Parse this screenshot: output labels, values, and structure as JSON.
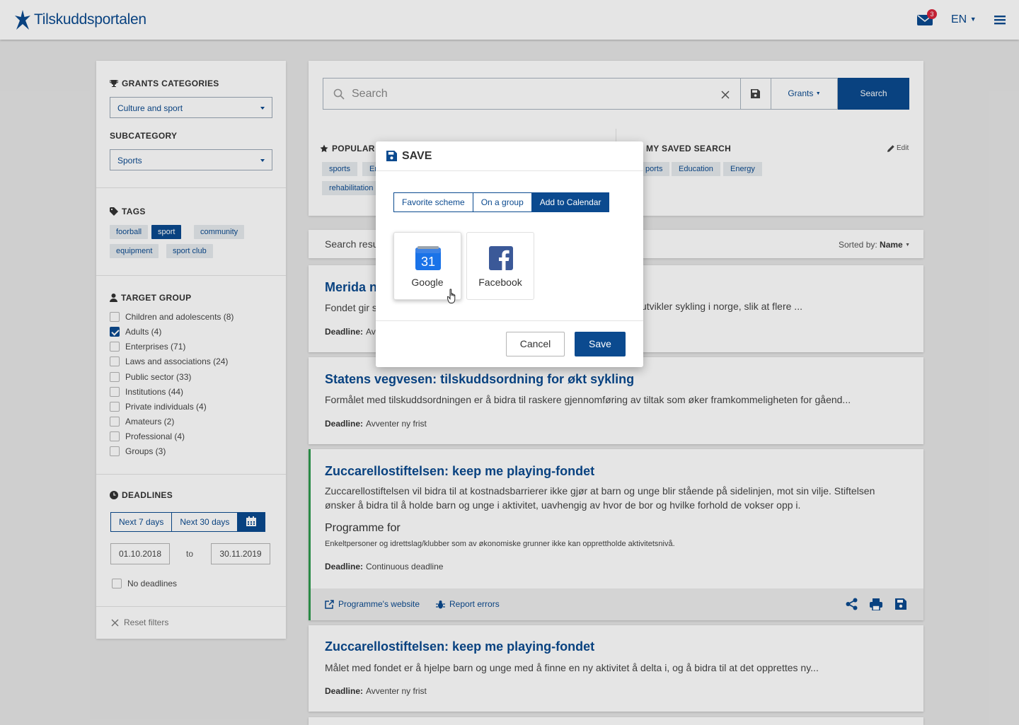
{
  "header": {
    "logo_text": "Tilskuddsportalen",
    "mail_count": "3",
    "language": "EN"
  },
  "sidebar": {
    "grants_heading": "GRANTS CATEGORIES",
    "grants_value": "Culture and sport",
    "subcategory_heading": "SUBCATEGORY",
    "subcategory_value": "Sports",
    "tags_heading": "TAGS",
    "tags": [
      {
        "label": "foorball",
        "active": false
      },
      {
        "label": "sport",
        "active": true
      },
      {
        "label": "community",
        "active": false
      },
      {
        "label": "equipment",
        "active": false
      },
      {
        "label": "sport club",
        "active": false
      }
    ],
    "target_heading": "TARGET GROUP",
    "target_items": [
      {
        "label": "Children and adolescents (8)",
        "checked": false
      },
      {
        "label": "Adults (4)",
        "checked": true
      },
      {
        "label": "Enterprises (71)",
        "checked": false
      },
      {
        "label": "Laws and associations (24)",
        "checked": false
      },
      {
        "label": "Public sector (33)",
        "checked": false
      },
      {
        "label": "Institutions (44)",
        "checked": false
      },
      {
        "label": "Private individuals (4)",
        "checked": false
      },
      {
        "label": "Amateurs (2)",
        "checked": false
      },
      {
        "label": "Professional (4)",
        "checked": false
      },
      {
        "label": "Groups (3)",
        "checked": false
      }
    ],
    "deadlines_heading": "DEADLINES",
    "deadline_next7": "Next 7 days",
    "deadline_next30": "Next 30 days",
    "date_from": "01.10.2018",
    "date_to_label": "to",
    "date_to": "30.11.2019",
    "no_deadlines": "No deadlines",
    "reset_filters": "Reset filters"
  },
  "search": {
    "placeholder": "Search",
    "scope": "Grants",
    "button": "Search",
    "popular_heading": "POPULAR",
    "popular_chips": [
      "sports",
      "Er",
      "rehabilitation"
    ],
    "saved_heading": "MY SAVED SEARCH",
    "saved_edit": "Edit",
    "saved_chips": [
      "ports",
      "Education",
      "Energy"
    ]
  },
  "results": {
    "label": "Search resu",
    "sorted_label": "Sorted by:",
    "sorted_value": "Name"
  },
  "cards": [
    {
      "title": "Merida n",
      "desc": "Fondet gir s",
      "desc_right": "utvikler sykling i norge, slik at flere ...",
      "deadline_label": "Deadline:",
      "deadline_value": "Av"
    },
    {
      "title": "Statens vegvesen: tilskuddsordning for økt sykling",
      "desc": "Formålet med tilskuddsordningen er å bidra til raskere gjennomføring av tiltak som øker framkommeligheten for gåend...",
      "deadline_label": "Deadline:",
      "deadline_value": "Avventer ny frist"
    },
    {
      "title": "Zuccarellostiftelsen: keep me playing-fondet",
      "desc": "Zuccarellostiftelsen vil bidra til at kostnadsbarrierer ikke gjør at barn og unge blir stående på sidelinjen, mot sin vilje. Stiftelsen ønsker å bidra til å holde barn og unge i aktivitet, uavhengig av hvor de bor og hvilke forhold de vokser opp i.",
      "programme_heading": "Programme for",
      "programme_text": "Enkeltpersoner og idrettslag/klubber som av økonomiske grunner ikke kan opprettholde aktivitetsnivå.",
      "deadline_label": "Deadline:",
      "deadline_value": "Continuous deadline",
      "link_website": "Programme's website",
      "link_report": "Report errors"
    },
    {
      "title": "Zuccarellostiftelsen: keep me playing-fondet",
      "desc": "Målet med fondet er å hjelpe barn og unge med å finne en ny aktivitet å delta i, og å bidra til at det opprettes ny...",
      "deadline_label": "Deadline:",
      "deadline_value": "Avventer ny frist"
    }
  ],
  "modal": {
    "title": "SAVE",
    "tabs": [
      "Favorite scheme",
      "On a group",
      "Add to Calendar"
    ],
    "active_tab": "Add to Calendar",
    "google_day": "31",
    "google_label": "Google",
    "facebook_label": "Facebook",
    "cancel": "Cancel",
    "save": "Save"
  },
  "colors": {
    "brand": "#0b4a8f",
    "accent_border": "#2e9a4d",
    "badge": "#d9253b"
  }
}
